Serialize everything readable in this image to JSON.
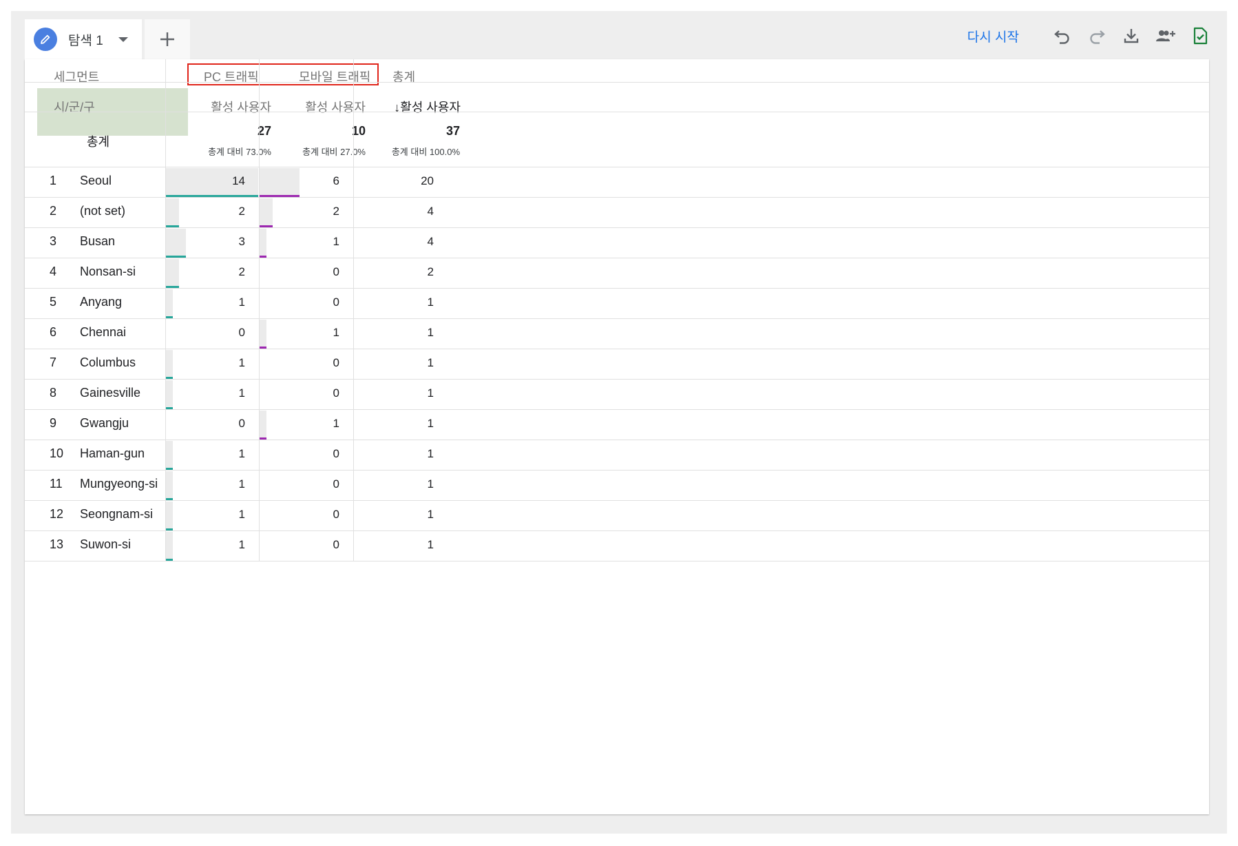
{
  "tabs": {
    "active_label": "탐색 1"
  },
  "toolbar": {
    "restart_label": "다시 시작"
  },
  "colors": {
    "pc_bar": "#26a69a",
    "mobile_bar": "#9c27b0",
    "selected_dimension": "#d6e2cf",
    "highlight_box": "#e0241a",
    "accent": "#1a73e8"
  },
  "table": {
    "segment_header": "세그먼트",
    "dimension_header": "시/군/구",
    "segments": [
      "PC 트래픽",
      "모바일 트래픽",
      "총계"
    ],
    "metric_headers": [
      "활성 사용자",
      "활성 사용자",
      "↓활성 사용자"
    ],
    "totals": {
      "label": "총계",
      "values": [
        "27",
        "10",
        "37"
      ],
      "percents": [
        "총계 대비 73.0%",
        "총계 대비 27.0%",
        "총계 대비 100.0%"
      ]
    },
    "rows": [
      {
        "rank": "1",
        "city": "Seoul",
        "pc": 14,
        "mobile": 6,
        "total": 20
      },
      {
        "rank": "2",
        "city": "(not set)",
        "pc": 2,
        "mobile": 2,
        "total": 4
      },
      {
        "rank": "3",
        "city": "Busan",
        "pc": 3,
        "mobile": 1,
        "total": 4
      },
      {
        "rank": "4",
        "city": "Nonsan-si",
        "pc": 2,
        "mobile": 0,
        "total": 2
      },
      {
        "rank": "5",
        "city": "Anyang",
        "pc": 1,
        "mobile": 0,
        "total": 1
      },
      {
        "rank": "6",
        "city": "Chennai",
        "pc": 0,
        "mobile": 1,
        "total": 1
      },
      {
        "rank": "7",
        "city": "Columbus",
        "pc": 1,
        "mobile": 0,
        "total": 1
      },
      {
        "rank": "8",
        "city": "Gainesville",
        "pc": 1,
        "mobile": 0,
        "total": 1
      },
      {
        "rank": "9",
        "city": "Gwangju",
        "pc": 0,
        "mobile": 1,
        "total": 1
      },
      {
        "rank": "10",
        "city": "Haman-gun",
        "pc": 1,
        "mobile": 0,
        "total": 1
      },
      {
        "rank": "11",
        "city": "Mungyeong-si",
        "pc": 1,
        "mobile": 0,
        "total": 1
      },
      {
        "rank": "12",
        "city": "Seongnam-si",
        "pc": 1,
        "mobile": 0,
        "total": 1
      },
      {
        "rank": "13",
        "city": "Suwon-si",
        "pc": 1,
        "mobile": 0,
        "total": 1
      }
    ]
  }
}
